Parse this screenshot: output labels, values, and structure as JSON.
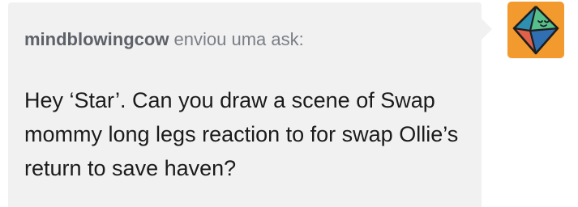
{
  "ask": {
    "asker": "mindblowingcow",
    "action_text": " enviou uma ask:",
    "body": "Hey ‘Star’. Can you draw a scene of Swap mommy long legs reaction to for swap Ollie’s return to save haven?"
  },
  "avatar": {
    "icon": "octahedron-face-icon",
    "background_color": "#f29a2e"
  },
  "colors": {
    "bubble": "#f1f1f2",
    "text": "#1b1b1b",
    "header_text": "#7a7e86"
  }
}
